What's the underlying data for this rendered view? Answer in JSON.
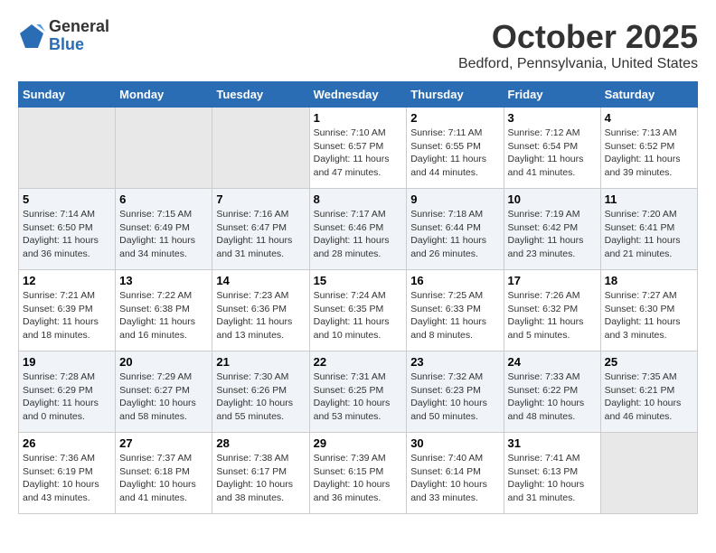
{
  "logo": {
    "general": "General",
    "blue": "Blue"
  },
  "title": "October 2025",
  "location": "Bedford, Pennsylvania, United States",
  "days_of_week": [
    "Sunday",
    "Monday",
    "Tuesday",
    "Wednesday",
    "Thursday",
    "Friday",
    "Saturday"
  ],
  "weeks": [
    [
      {
        "num": "",
        "info": ""
      },
      {
        "num": "",
        "info": ""
      },
      {
        "num": "",
        "info": ""
      },
      {
        "num": "1",
        "info": "Sunrise: 7:10 AM\nSunset: 6:57 PM\nDaylight: 11 hours and 47 minutes."
      },
      {
        "num": "2",
        "info": "Sunrise: 7:11 AM\nSunset: 6:55 PM\nDaylight: 11 hours and 44 minutes."
      },
      {
        "num": "3",
        "info": "Sunrise: 7:12 AM\nSunset: 6:54 PM\nDaylight: 11 hours and 41 minutes."
      },
      {
        "num": "4",
        "info": "Sunrise: 7:13 AM\nSunset: 6:52 PM\nDaylight: 11 hours and 39 minutes."
      }
    ],
    [
      {
        "num": "5",
        "info": "Sunrise: 7:14 AM\nSunset: 6:50 PM\nDaylight: 11 hours and 36 minutes."
      },
      {
        "num": "6",
        "info": "Sunrise: 7:15 AM\nSunset: 6:49 PM\nDaylight: 11 hours and 34 minutes."
      },
      {
        "num": "7",
        "info": "Sunrise: 7:16 AM\nSunset: 6:47 PM\nDaylight: 11 hours and 31 minutes."
      },
      {
        "num": "8",
        "info": "Sunrise: 7:17 AM\nSunset: 6:46 PM\nDaylight: 11 hours and 28 minutes."
      },
      {
        "num": "9",
        "info": "Sunrise: 7:18 AM\nSunset: 6:44 PM\nDaylight: 11 hours and 26 minutes."
      },
      {
        "num": "10",
        "info": "Sunrise: 7:19 AM\nSunset: 6:42 PM\nDaylight: 11 hours and 23 minutes."
      },
      {
        "num": "11",
        "info": "Sunrise: 7:20 AM\nSunset: 6:41 PM\nDaylight: 11 hours and 21 minutes."
      }
    ],
    [
      {
        "num": "12",
        "info": "Sunrise: 7:21 AM\nSunset: 6:39 PM\nDaylight: 11 hours and 18 minutes."
      },
      {
        "num": "13",
        "info": "Sunrise: 7:22 AM\nSunset: 6:38 PM\nDaylight: 11 hours and 16 minutes."
      },
      {
        "num": "14",
        "info": "Sunrise: 7:23 AM\nSunset: 6:36 PM\nDaylight: 11 hours and 13 minutes."
      },
      {
        "num": "15",
        "info": "Sunrise: 7:24 AM\nSunset: 6:35 PM\nDaylight: 11 hours and 10 minutes."
      },
      {
        "num": "16",
        "info": "Sunrise: 7:25 AM\nSunset: 6:33 PM\nDaylight: 11 hours and 8 minutes."
      },
      {
        "num": "17",
        "info": "Sunrise: 7:26 AM\nSunset: 6:32 PM\nDaylight: 11 hours and 5 minutes."
      },
      {
        "num": "18",
        "info": "Sunrise: 7:27 AM\nSunset: 6:30 PM\nDaylight: 11 hours and 3 minutes."
      }
    ],
    [
      {
        "num": "19",
        "info": "Sunrise: 7:28 AM\nSunset: 6:29 PM\nDaylight: 11 hours and 0 minutes."
      },
      {
        "num": "20",
        "info": "Sunrise: 7:29 AM\nSunset: 6:27 PM\nDaylight: 10 hours and 58 minutes."
      },
      {
        "num": "21",
        "info": "Sunrise: 7:30 AM\nSunset: 6:26 PM\nDaylight: 10 hours and 55 minutes."
      },
      {
        "num": "22",
        "info": "Sunrise: 7:31 AM\nSunset: 6:25 PM\nDaylight: 10 hours and 53 minutes."
      },
      {
        "num": "23",
        "info": "Sunrise: 7:32 AM\nSunset: 6:23 PM\nDaylight: 10 hours and 50 minutes."
      },
      {
        "num": "24",
        "info": "Sunrise: 7:33 AM\nSunset: 6:22 PM\nDaylight: 10 hours and 48 minutes."
      },
      {
        "num": "25",
        "info": "Sunrise: 7:35 AM\nSunset: 6:21 PM\nDaylight: 10 hours and 46 minutes."
      }
    ],
    [
      {
        "num": "26",
        "info": "Sunrise: 7:36 AM\nSunset: 6:19 PM\nDaylight: 10 hours and 43 minutes."
      },
      {
        "num": "27",
        "info": "Sunrise: 7:37 AM\nSunset: 6:18 PM\nDaylight: 10 hours and 41 minutes."
      },
      {
        "num": "28",
        "info": "Sunrise: 7:38 AM\nSunset: 6:17 PM\nDaylight: 10 hours and 38 minutes."
      },
      {
        "num": "29",
        "info": "Sunrise: 7:39 AM\nSunset: 6:15 PM\nDaylight: 10 hours and 36 minutes."
      },
      {
        "num": "30",
        "info": "Sunrise: 7:40 AM\nSunset: 6:14 PM\nDaylight: 10 hours and 33 minutes."
      },
      {
        "num": "31",
        "info": "Sunrise: 7:41 AM\nSunset: 6:13 PM\nDaylight: 10 hours and 31 minutes."
      },
      {
        "num": "",
        "info": ""
      }
    ]
  ]
}
